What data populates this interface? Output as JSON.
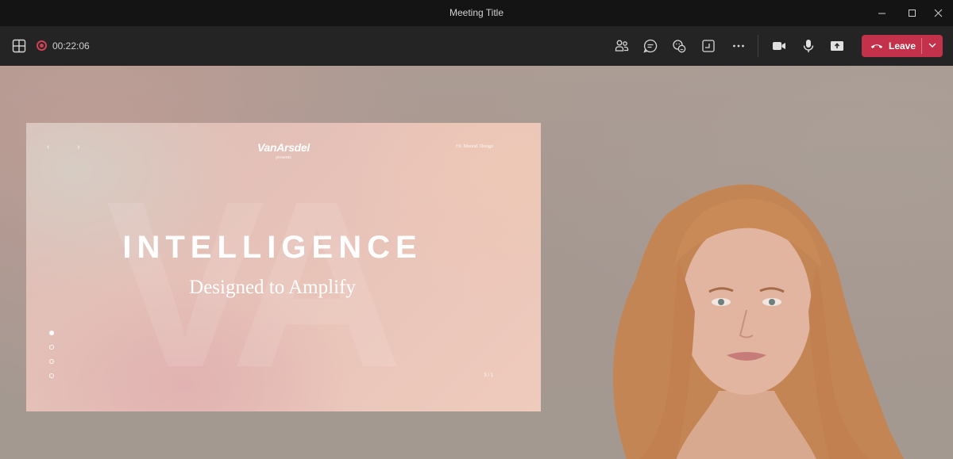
{
  "window": {
    "title": "Meeting Title"
  },
  "toolbar": {
    "recording_time": "00:22:06",
    "leave_label": "Leave",
    "icons": [
      "layout-icon",
      "recording-icon",
      "people-icon",
      "chat-icon",
      "reactions-icon",
      "rooms-icon",
      "more-icon",
      "camera-icon",
      "mic-icon",
      "share-icon",
      "hangup-icon",
      "chevron-down-icon"
    ],
    "leave_color": "#c4314b"
  },
  "slide": {
    "logo": "VanArsdel",
    "presents": "presents",
    "corner_text": "Fit. Mound. Design",
    "headline": "INTELLIGENCE",
    "subline": "Designed to Amplify",
    "watermark": "VA",
    "page_number": "3 / 1"
  }
}
